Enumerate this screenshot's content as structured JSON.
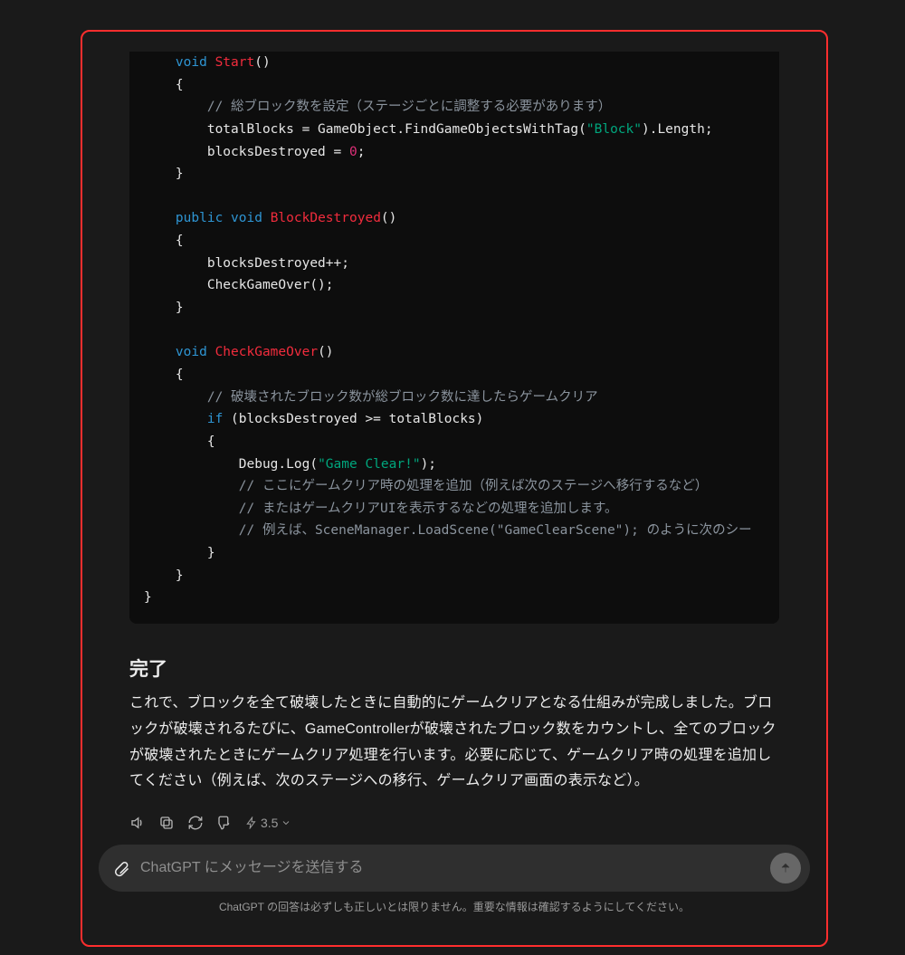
{
  "code": {
    "lines": [
      [
        [
          "    ",
          ""
        ],
        [
          "void",
          "kw"
        ],
        [
          " ",
          ""
        ],
        [
          "Start",
          "fn"
        ],
        [
          "()",
          ""
        ]
      ],
      [
        [
          "    {",
          ""
        ]
      ],
      [
        [
          "        ",
          ""
        ],
        [
          "// 総ブロック数を設定（ステージごとに調整する必要があります）",
          "com"
        ]
      ],
      [
        [
          "        totalBlocks = GameObject.FindGameObjectsWithTag(",
          ""
        ],
        [
          "\"Block\"",
          "str"
        ],
        [
          ").Length;",
          ""
        ]
      ],
      [
        [
          "        blocksDestroyed = ",
          ""
        ],
        [
          "0",
          "num"
        ],
        [
          ";",
          ""
        ]
      ],
      [
        [
          "    }",
          ""
        ]
      ],
      [
        [
          "",
          ""
        ]
      ],
      [
        [
          "    ",
          ""
        ],
        [
          "public",
          "kw"
        ],
        [
          " ",
          ""
        ],
        [
          "void",
          "kw"
        ],
        [
          " ",
          ""
        ],
        [
          "BlockDestroyed",
          "fn"
        ],
        [
          "()",
          ""
        ]
      ],
      [
        [
          "    {",
          ""
        ]
      ],
      [
        [
          "        blocksDestroyed++;",
          ""
        ]
      ],
      [
        [
          "        CheckGameOver();",
          ""
        ]
      ],
      [
        [
          "    }",
          ""
        ]
      ],
      [
        [
          "",
          ""
        ]
      ],
      [
        [
          "    ",
          ""
        ],
        [
          "void",
          "kw"
        ],
        [
          " ",
          ""
        ],
        [
          "CheckGameOver",
          "fn"
        ],
        [
          "()",
          ""
        ]
      ],
      [
        [
          "    {",
          ""
        ]
      ],
      [
        [
          "        ",
          ""
        ],
        [
          "// 破壊されたブロック数が総ブロック数に達したらゲームクリア",
          "com"
        ]
      ],
      [
        [
          "        ",
          ""
        ],
        [
          "if",
          "kw"
        ],
        [
          " (blocksDestroyed >= totalBlocks)",
          ""
        ]
      ],
      [
        [
          "        {",
          ""
        ]
      ],
      [
        [
          "            Debug.Log(",
          ""
        ],
        [
          "\"Game Clear!\"",
          "str"
        ],
        [
          ");",
          ""
        ]
      ],
      [
        [
          "            ",
          ""
        ],
        [
          "// ここにゲームクリア時の処理を追加（例えば次のステージへ移行するなど）",
          "com"
        ]
      ],
      [
        [
          "            ",
          ""
        ],
        [
          "// またはゲームクリアUIを表示するなどの処理を追加します。",
          "com"
        ]
      ],
      [
        [
          "            ",
          ""
        ],
        [
          "// 例えば、SceneManager.LoadScene(\"GameClearScene\"); のように次のシー",
          "com"
        ]
      ],
      [
        [
          "        }",
          ""
        ]
      ],
      [
        [
          "    }",
          ""
        ]
      ],
      [
        [
          "}",
          ""
        ]
      ]
    ]
  },
  "section": {
    "title": "完了",
    "body": "これで、ブロックを全て破壊したときに自動的にゲームクリアとなる仕組みが完成しました。ブロックが破壊されるたびに、GameControllerが破壊されたブロック数をカウントし、全てのブロックが破壊されたときにゲームクリア処理を行います。必要に応じて、ゲームクリア時の処理を追加してください（例えば、次のステージへの移行、ゲームクリア画面の表示など）。"
  },
  "actions": {
    "model": "3.5"
  },
  "composer": {
    "placeholder": "ChatGPT にメッセージを送信する"
  },
  "disclaimer": "ChatGPT の回答は必ずしも正しいとは限りません。重要な情報は確認するようにしてください。"
}
